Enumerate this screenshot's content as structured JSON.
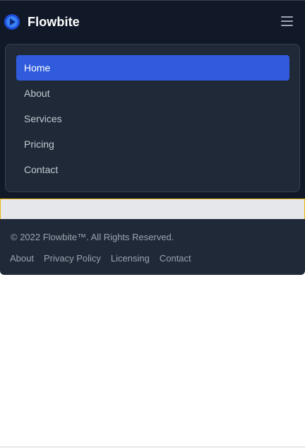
{
  "navbar": {
    "brand": "Flowbite",
    "logo_icon": "flowbite-logo-icon",
    "menu_icon": "hamburger-menu-icon",
    "background": "#111827"
  },
  "menu": {
    "items": [
      {
        "label": "Home",
        "active": true
      },
      {
        "label": "About",
        "active": false
      },
      {
        "label": "Services",
        "active": false
      },
      {
        "label": "Pricing",
        "active": false
      },
      {
        "label": "Contact",
        "active": false
      }
    ],
    "active_color": "#2f5bdc",
    "background": "#1f2937"
  },
  "footer": {
    "copyright": "© 2022 Flowbite™. All Rights Reserved.",
    "links": [
      "About",
      "Privacy Policy",
      "Licensing",
      "Contact"
    ],
    "background": "#1f2937"
  }
}
